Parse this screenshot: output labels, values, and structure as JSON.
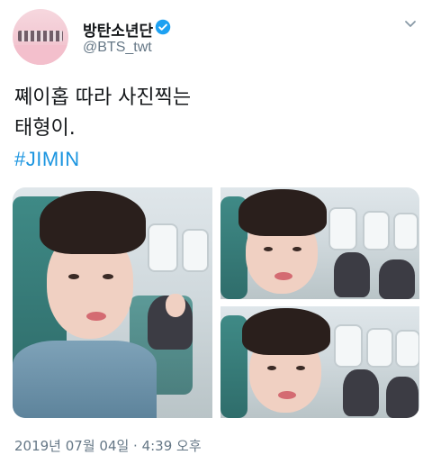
{
  "header": {
    "display_name": "방탄소년단",
    "handle": "@BTS_twt",
    "verified": true,
    "menu_icon": "chevron-down-icon"
  },
  "tweet": {
    "lines": [
      "쪠이홉 따라 사진찍는",
      "태형이."
    ],
    "hashtag": "#JIMIN"
  },
  "media": {
    "count": 3
  },
  "timestamp": "2019년 07월 04일 · 4:39 오후",
  "colors": {
    "link": "#1b95e0",
    "secondary_text": "#657786",
    "verified": "#1da1f2"
  }
}
